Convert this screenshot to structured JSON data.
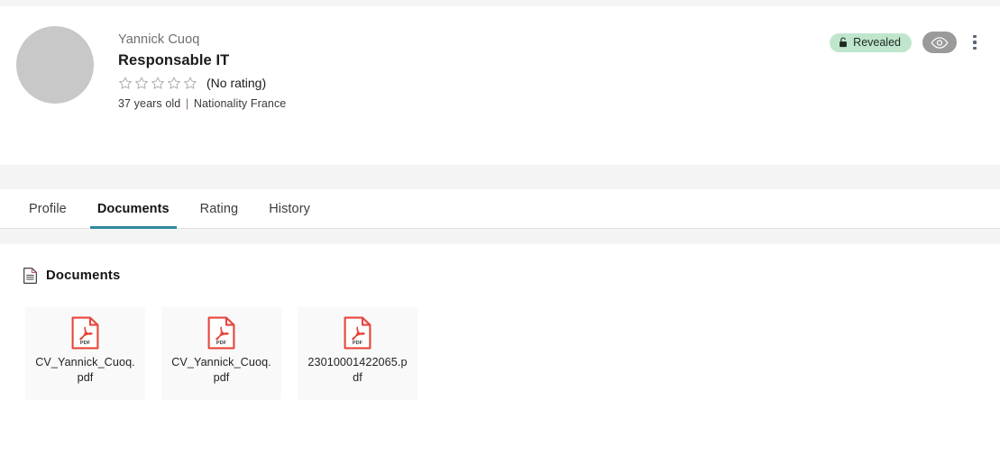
{
  "header": {
    "avatar": {
      "icon": "avatar-placeholder-circle",
      "color": "#c8c8c8"
    },
    "person_name": "Yannick Cuoq",
    "person_title": "Responsable IT",
    "rating": {
      "stars_total": 5,
      "stars_filled": 0,
      "label": "(No rating)",
      "star_icon": "star-outline-icon"
    },
    "meta": {
      "age": "37 years old",
      "separator": "|",
      "nationality": "Nationality France"
    },
    "status_badge": {
      "label": "Revealed",
      "icon": "unlock-icon",
      "background": "#bfe6cd",
      "text_color": "#202a22"
    },
    "eye_button": {
      "icon": "eye-icon",
      "background": "#9a9a9a"
    },
    "overflow_menu": {
      "icon": "kebab-menu-icon",
      "color": "#5a6673"
    }
  },
  "tabs": {
    "items": [
      {
        "label": "Profile",
        "active": false
      },
      {
        "label": "Documents",
        "active": true
      },
      {
        "label": "Rating",
        "active": false
      },
      {
        "label": "History",
        "active": false
      }
    ],
    "active_underline_color": "#2f8aa0"
  },
  "documents_section": {
    "icon": "document-icon",
    "title": "Documents",
    "files": [
      {
        "name": "CV_Yannick_Cuoq.pdf",
        "type": "PDF",
        "icon": "pdf-file-icon"
      },
      {
        "name": "CV_Yannick_Cuoq.pdf",
        "type": "PDF",
        "icon": "pdf-file-icon"
      },
      {
        "name": "23010001422065.pdf",
        "type": "PDF",
        "icon": "pdf-file-icon"
      }
    ],
    "pdf_accent_color": "#e8453c"
  }
}
